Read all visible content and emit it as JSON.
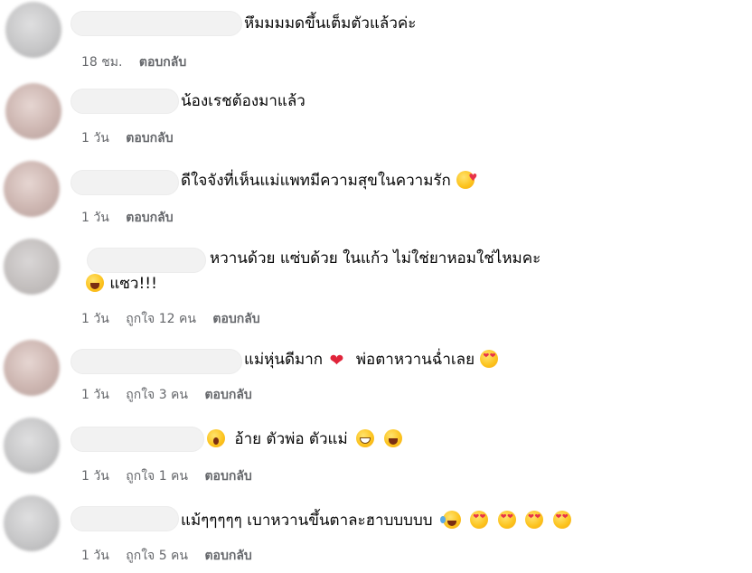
{
  "comments": [
    {
      "text": "หึมมมมดขึ้นเต็มตัวแล้วค่ะ",
      "time": "18 ชม.",
      "reply": "ตอบกลับ"
    },
    {
      "text": "น้องเรชต้องมาแล้ว",
      "time": "1 วัน",
      "reply": "ตอบกลับ"
    },
    {
      "text": "ดีใจจังที่เห็นแม่แพทมีความสุขในความรัก",
      "emoji_after": "smiling-face-with-hearts-icon",
      "time": "1 วัน",
      "reply": "ตอบกลับ"
    },
    {
      "text": "หวานด้วย แซ่บด้วย ในแก้ว ไม่ใช่ยาหอมใช่ไหมคะ",
      "line2": "แซว!!!",
      "emoji_line2": "laughing-face-icon",
      "time": "1 วัน",
      "likes": "ถูกใจ 12 คน",
      "reply": "ตอบกลับ"
    },
    {
      "text_a": "แม่หุ่นดีมาก",
      "text_b": "พ่อตาหวานฉ่ำเลย",
      "emojis": [
        "red-heart-icon",
        "heart-eyes-icon"
      ],
      "time": "1 วัน",
      "likes": "ถูกใจ 3 คน",
      "reply": "ตอบกลับ"
    },
    {
      "text_a": "อ้าย ตัวพ่อ ตัวแม่",
      "emojis": [
        "surprised-face-icon",
        "grinning-face-icon",
        "laughing-face-icon"
      ],
      "time": "1 วัน",
      "likes": "ถูกใจ 1 คน",
      "reply": "ตอบกลับ"
    },
    {
      "text": "แม้ๆๆๆๆๆ เบาหวานขึ้นตาละฮาบบบบบ",
      "emojis": [
        "tears-of-joy-icon",
        "heart-eyes-icon",
        "heart-eyes-icon",
        "heart-eyes-icon",
        "heart-eyes-icon"
      ],
      "time": "1 วัน",
      "likes": "ถูกใจ 5 คน",
      "reply": "ตอบกลับ"
    }
  ],
  "colors": {
    "text": "#050505",
    "meta": "#65676b",
    "heart": "#e0243a"
  }
}
